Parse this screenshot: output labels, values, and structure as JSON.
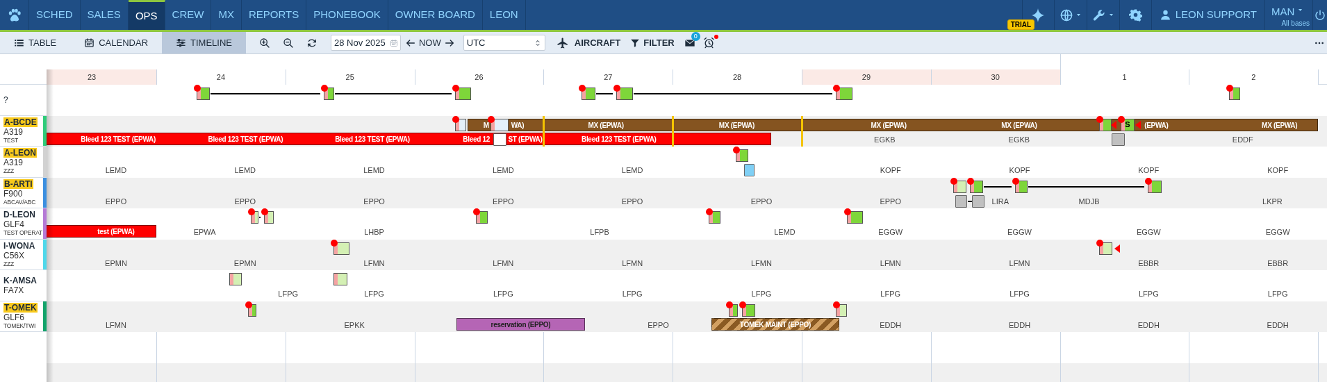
{
  "nav": {
    "tabs": [
      {
        "label": "SCHED",
        "selected": false
      },
      {
        "label": "SALES",
        "selected": false
      },
      {
        "label": "OPS",
        "selected": true
      },
      {
        "label": "CREW",
        "selected": false
      },
      {
        "label": "MX",
        "selected": false
      },
      {
        "label": "REPORTS",
        "selected": false
      },
      {
        "label": "PHONEBOOK",
        "selected": false
      },
      {
        "label": "OWNER BOARD",
        "selected": false
      },
      {
        "label": "LEON",
        "selected": false
      }
    ],
    "trial_badge": "TRIAL",
    "user": "LEON SUPPORT",
    "base": "MAN",
    "base_scope": "All bases"
  },
  "toolbar": {
    "views": [
      {
        "label": "TABLE",
        "selected": false
      },
      {
        "label": "CALENDAR",
        "selected": false
      },
      {
        "label": "TIMELINE",
        "selected": true
      }
    ],
    "date": "28 Nov 2025",
    "now": "NOW",
    "timezone": "UTC",
    "aircraft": "AIRCRAFT",
    "filter": "FILTER",
    "messages": "0"
  },
  "days": [
    {
      "label": "23",
      "weekend": true,
      "new_month": false
    },
    {
      "label": "24",
      "weekend": false,
      "new_month": false
    },
    {
      "label": "25",
      "weekend": false,
      "new_month": false
    },
    {
      "label": "26",
      "weekend": false,
      "new_month": false
    },
    {
      "label": "27",
      "weekend": false,
      "new_month": false
    },
    {
      "label": "28",
      "weekend": false,
      "new_month": false
    },
    {
      "label": "29",
      "weekend": true,
      "new_month": false
    },
    {
      "label": "30",
      "weekend": true,
      "new_month": false
    },
    {
      "label": "1",
      "weekend": false,
      "new_month": true
    },
    {
      "label": "2",
      "weekend": false,
      "new_month": false
    }
  ],
  "rows": [
    {
      "registration": "?",
      "highlighted": false,
      "items": [
        {
          "kind": "flight",
          "color": "#7ed63a",
          "alert": true
        },
        {
          "kind": "link"
        },
        {
          "kind": "flight",
          "color": "#7ed63a",
          "alert": true
        },
        {
          "kind": "link"
        },
        {
          "kind": "flight",
          "color": "#7ed63a",
          "alert": true
        },
        {
          "kind": "flight",
          "color": "#7ed63a",
          "alert": true
        },
        {
          "kind": "link"
        },
        {
          "kind": "flight",
          "color": "#7ed63a",
          "alert": true
        },
        {
          "kind": "link"
        },
        {
          "kind": "flight",
          "color": "#7ed63a",
          "alert": true
        },
        {
          "kind": "flight",
          "color": "#7ed63a",
          "alert": true
        }
      ]
    },
    {
      "registration": "A-BCDE",
      "type": "A319",
      "operator": "TEST",
      "highlighted": true,
      "color": "#2fcc7a",
      "items": [
        {
          "kind": "flight",
          "color": "#e4f0fb",
          "alert": true
        },
        {
          "kind": "upper-bar",
          "color": "#855420"
        },
        {
          "kind": "upper-bar-label",
          "text": "M",
          "dark": false
        },
        {
          "kind": "flight",
          "color": "#e4f0fb",
          "alert": true
        },
        {
          "kind": "upper-bar-label",
          "text": "WA)",
          "dark": false
        },
        {
          "kind": "marker"
        },
        {
          "kind": "upper-bar",
          "color": "#855420"
        },
        {
          "kind": "upper-bar-label",
          "text": "MX (EPWA)",
          "dark": false
        },
        {
          "kind": "marker"
        },
        {
          "kind": "upper-bar",
          "color": "#855420"
        },
        {
          "kind": "upper-bar-label",
          "text": "MX (EPWA)",
          "dark": false
        },
        {
          "kind": "marker"
        },
        {
          "kind": "upper-bar",
          "color": "#855420"
        },
        {
          "kind": "upper-bar-label",
          "text": "MX (EPWA)",
          "dark": false
        },
        {
          "kind": "upper-bar-label",
          "text": "MX (EPWA)",
          "dark": false
        },
        {
          "kind": "flight",
          "color": "#7ed63a",
          "alert": true
        },
        {
          "kind": "flag"
        },
        {
          "kind": "flight",
          "color": "#7ed63a",
          "alert": true,
          "text": "S"
        },
        {
          "kind": "flag"
        },
        {
          "kind": "upper-bar-label",
          "text": "(EPWA)",
          "dark": false
        },
        {
          "kind": "upper-bar-label",
          "text": "MX (EPWA)",
          "dark": false
        },
        {
          "kind": "bar",
          "color": "#ff0000"
        },
        {
          "kind": "bar-label",
          "text": "Bleed 123 TEST (EPWA)",
          "dark": false
        },
        {
          "kind": "bar-label",
          "text": "Bleed 123 TEST (EPWA)",
          "dark": false
        },
        {
          "kind": "bar-label",
          "text": "Bleed 123 TEST (EPWA)",
          "dark": false
        },
        {
          "kind": "bar-label",
          "text": "Bleed 12",
          "dark": false
        },
        {
          "kind": "slot",
          "color": "#ffffff"
        },
        {
          "kind": "bar-label",
          "text": "ST (EPWA)",
          "dark": false
        },
        {
          "kind": "bar-label",
          "text": "Bleed 123 TEST (EPWA)",
          "dark": false
        },
        {
          "kind": "station",
          "text": "EGKB"
        },
        {
          "kind": "station",
          "text": "EGKB"
        },
        {
          "kind": "slot",
          "color": "#c0c0c0"
        },
        {
          "kind": "station",
          "text": "EDDF"
        }
      ]
    },
    {
      "registration": "A-LEON",
      "type": "A319",
      "operator": "ZZZ",
      "highlighted": true,
      "color": "#d2d2d2",
      "items": [
        {
          "kind": "flight",
          "color": "#7ed63a",
          "alert": true
        },
        {
          "kind": "station",
          "text": "LEMD"
        },
        {
          "kind": "station",
          "text": "LEMD"
        },
        {
          "kind": "station",
          "text": "LEMD"
        },
        {
          "kind": "station",
          "text": "LEMD"
        },
        {
          "kind": "station",
          "text": "LEMD"
        },
        {
          "kind": "slot",
          "color": "#80d0f5"
        },
        {
          "kind": "station",
          "text": "KOPF"
        },
        {
          "kind": "station",
          "text": "KOPF"
        },
        {
          "kind": "station",
          "text": "KOPF"
        },
        {
          "kind": "station",
          "text": "KOPF"
        }
      ]
    },
    {
      "registration": "B-ARTI",
      "type": "F900",
      "operator": "ABCAV/ABC",
      "highlighted": true,
      "color": "#3b8fe0",
      "items": [
        {
          "kind": "flight",
          "color": "#d4f0b4",
          "alert": true
        },
        {
          "kind": "link"
        },
        {
          "kind": "flight",
          "color": "#7ed63a",
          "alert": true
        },
        {
          "kind": "link"
        },
        {
          "kind": "flight",
          "color": "#7ed63a",
          "alert": true
        },
        {
          "kind": "link"
        },
        {
          "kind": "flight",
          "color": "#7ed63a",
          "alert": true
        },
        {
          "kind": "station",
          "text": "EPPO"
        },
        {
          "kind": "station",
          "text": "EPPO"
        },
        {
          "kind": "station",
          "text": "EPPO"
        },
        {
          "kind": "station",
          "text": "EPPO"
        },
        {
          "kind": "station",
          "text": "EPPO"
        },
        {
          "kind": "station",
          "text": "EPPO"
        },
        {
          "kind": "station",
          "text": "EPPO"
        },
        {
          "kind": "slot",
          "color": "#c0c0c0"
        },
        {
          "kind": "slot-link"
        },
        {
          "kind": "slot",
          "color": "#c0c0c0"
        },
        {
          "kind": "station",
          "text": "LIRA"
        },
        {
          "kind": "station",
          "text": "MDJB"
        },
        {
          "kind": "station",
          "text": "LKPR"
        }
      ]
    },
    {
      "registration": "D-LEON",
      "type": "GLF4",
      "operator": "TEST OPERAT",
      "highlighted": false,
      "color": "#b57ad6",
      "items": [
        {
          "kind": "flight",
          "color": "#d4f0b4",
          "alert": true
        },
        {
          "kind": "link"
        },
        {
          "kind": "flight",
          "color": "#d4f0b4",
          "alert": true
        },
        {
          "kind": "flight",
          "color": "#7ed63a",
          "alert": true
        },
        {
          "kind": "flight",
          "color": "#7ed63a",
          "alert": true
        },
        {
          "kind": "flight",
          "color": "#7ed63a",
          "alert": true
        },
        {
          "kind": "bar",
          "color": "#ff0000"
        },
        {
          "kind": "bar-label",
          "text": "test (EPWA)",
          "dark": false
        },
        {
          "kind": "station",
          "text": "EPWA"
        },
        {
          "kind": "station",
          "text": "LHBP"
        },
        {
          "kind": "station",
          "text": "LFPB"
        },
        {
          "kind": "station",
          "text": "LEMD"
        },
        {
          "kind": "station",
          "text": "EGGW"
        },
        {
          "kind": "station",
          "text": "EGGW"
        },
        {
          "kind": "station",
          "text": "EGGW"
        },
        {
          "kind": "station",
          "text": "EGGW"
        }
      ]
    },
    {
      "registration": "I-WONA",
      "type": "C56X",
      "operator": "ZZZ",
      "highlighted": false,
      "color": "#4fd8ea",
      "items": [
        {
          "kind": "flight",
          "color": "#d4f0b4",
          "alert": true
        },
        {
          "kind": "flight",
          "color": "#d4f0b4",
          "alert": true
        },
        {
          "kind": "flag"
        },
        {
          "kind": "station",
          "text": "EPMN"
        },
        {
          "kind": "station",
          "text": "EPMN"
        },
        {
          "kind": "station",
          "text": "LFMN"
        },
        {
          "kind": "station",
          "text": "LFMN"
        },
        {
          "kind": "station",
          "text": "LFMN"
        },
        {
          "kind": "station",
          "text": "LFMN"
        },
        {
          "kind": "station",
          "text": "LFMN"
        },
        {
          "kind": "station",
          "text": "LFMN"
        },
        {
          "kind": "station",
          "text": "EBBR"
        },
        {
          "kind": "station",
          "text": "EBBR"
        }
      ]
    },
    {
      "registration": "K-AMSA",
      "type": "FA7X",
      "highlighted": false,
      "items": [
        {
          "kind": "flight",
          "color": "#d4f0b4",
          "alert": false
        },
        {
          "kind": "flight",
          "color": "#d4f0b4",
          "alert": false
        },
        {
          "kind": "station",
          "text": "LFPG"
        },
        {
          "kind": "station",
          "text": "LFPG"
        },
        {
          "kind": "station",
          "text": "LFPG"
        },
        {
          "kind": "station",
          "text": "LFPG"
        },
        {
          "kind": "station",
          "text": "LFPG"
        },
        {
          "kind": "station",
          "text": "LFPG"
        },
        {
          "kind": "station",
          "text": "LFPG"
        },
        {
          "kind": "station",
          "text": "LFPG"
        },
        {
          "kind": "station",
          "text": "LFPG"
        }
      ]
    },
    {
      "registration": "T-OMEK",
      "type": "GLF6",
      "operator": "TOMEK/TWI",
      "highlighted": true,
      "color": "#12a36a",
      "items": [
        {
          "kind": "flight",
          "color": "#7ed63a",
          "alert": true
        },
        {
          "kind": "flight",
          "color": "#7ed63a",
          "alert": true
        },
        {
          "kind": "link"
        },
        {
          "kind": "flight",
          "color": "#7ed63a",
          "alert": true
        },
        {
          "kind": "flight",
          "color": "#d4f0b4",
          "alert": true
        },
        {
          "kind": "station",
          "text": "LFMN"
        },
        {
          "kind": "station",
          "text": "EPKK"
        },
        {
          "kind": "bar",
          "color": "#b565b5"
        },
        {
          "kind": "bar-label",
          "text": "reservation (EPPO)",
          "dark": true
        },
        {
          "kind": "station",
          "text": "EPPO"
        },
        {
          "kind": "bar",
          "hatched": true
        },
        {
          "kind": "bar-label",
          "text": "TOMEK MAINT (EPPO)",
          "dark": false
        },
        {
          "kind": "station",
          "text": "EDDH"
        },
        {
          "kind": "station",
          "text": "EDDH"
        },
        {
          "kind": "station",
          "text": "EDDH"
        },
        {
          "kind": "station",
          "text": "EDDH"
        }
      ]
    }
  ]
}
